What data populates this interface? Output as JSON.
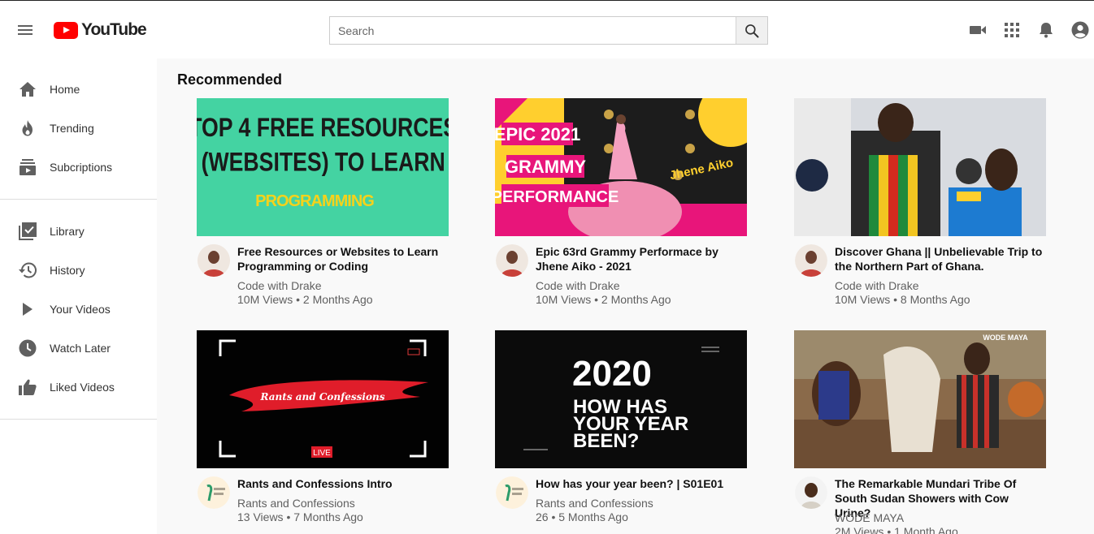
{
  "header": {
    "logo_text": "YouTube",
    "search_placeholder": "Search"
  },
  "sidebar": {
    "items": [
      {
        "label": "Home",
        "icon": "home-icon"
      },
      {
        "label": "Trending",
        "icon": "flame-icon"
      },
      {
        "label": "Subcriptions",
        "icon": "subscriptions-icon"
      },
      {
        "label": "Library",
        "icon": "library-icon"
      },
      {
        "label": "History",
        "icon": "history-icon"
      },
      {
        "label": "Your Videos",
        "icon": "play-icon"
      },
      {
        "label": "Watch Later",
        "icon": "clock-icon"
      },
      {
        "label": "Liked Videos",
        "icon": "thumbs-up-icon"
      }
    ]
  },
  "main": {
    "section_title": "Recommended",
    "videos": [
      {
        "title": "Free Resources or Websites to Learn Programming or Coding",
        "channel": "Code with Drake",
        "meta": "10M Views • 2 Months Ago",
        "thumb_lines": [
          "TOP 4 FREE RESOURCES",
          "(WEBSITES) TO LEARN"
        ],
        "thumb_sub": "PROGRAMMING"
      },
      {
        "title": "Epic 63rd Grammy Performace by Jhene Aiko - 2021",
        "channel": "Code with Drake",
        "meta": "10M Views • 2 Months Ago",
        "thumb_lines": [
          "EPIC 2021",
          "GRAMMY",
          "PERFORMANCE"
        ],
        "thumb_sub": "Jhene Aiko"
      },
      {
        "title": "Discover Ghana || Unbelievable Trip to the Northern Part of Ghana.",
        "channel": "Code with Drake",
        "meta": "10M Views • 8 Months Ago"
      },
      {
        "title": "Rants and Confessions Intro",
        "channel": "Rants and Confessions",
        "meta": "13 Views • 7 Months Ago",
        "thumb_lines": [
          "Rants and Confessions"
        ],
        "thumb_sub": "LIVE"
      },
      {
        "title": "How has your year been? | S01E01",
        "channel": "Rants and Confessions",
        "meta": "26 • 5 Months Ago",
        "thumb_lines": [
          "2020",
          "HOW HAS",
          "YOUR YEAR",
          "BEEN?"
        ]
      },
      {
        "title": "The Remarkable Mundari Tribe Of South Sudan Showers with Cow Urine?",
        "channel": "WODE MAYA",
        "meta": "2M Views • 1 Month Ago",
        "thumb_lines": [
          "WODE MAYA"
        ]
      }
    ]
  }
}
